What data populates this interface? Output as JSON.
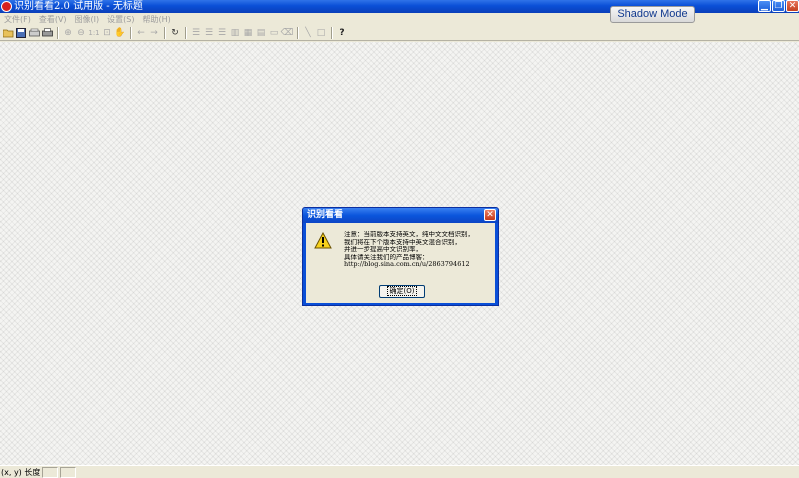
{
  "window": {
    "title": "识别看看2.0 试用版 - 无标题",
    "badge": "Shadow Mode",
    "controls": [
      "minimize-icon",
      "restore-icon",
      "close-icon"
    ]
  },
  "menu": {
    "items": [
      "文件(F)",
      "查看(V)",
      "图像(I)",
      "设置(S)",
      "帮助(H)"
    ]
  },
  "toolbar": {
    "zoom_label": "1:1",
    "icons": [
      "open-icon",
      "save-icon",
      "scan-icon",
      "print-icon",
      "zoom-in-icon",
      "zoom-out-icon",
      "actual-size-icon",
      "fit-icon",
      "hand-icon",
      "back-icon",
      "forward-icon",
      "rotate-icon",
      "align-left-icon",
      "align-center-icon",
      "align-right-icon",
      "image-left-icon",
      "image-both-icon",
      "image-right-icon",
      "frame-icon",
      "erase-icon",
      "line-icon",
      "rectangle-icon",
      "help-icon"
    ]
  },
  "statusbar": {
    "text": "(x, y) 长度"
  },
  "dialog": {
    "title": "识别看看",
    "icon": "warning-icon",
    "message": [
      "注意：当前版本支持英文，纯中文文档识别，",
      "我们将在下个版本支持中英文混合识别，",
      "并进一步提高中文识别率，",
      "具体请关注我们的产品博客：",
      "http://blog.sina.com.cn/u/2863794612"
    ],
    "ok_button": "确定(O)"
  },
  "colors": {
    "titlebar": "#0a4fd7",
    "chrome": "#ece9d8",
    "workspace": "#f4f4f2"
  }
}
